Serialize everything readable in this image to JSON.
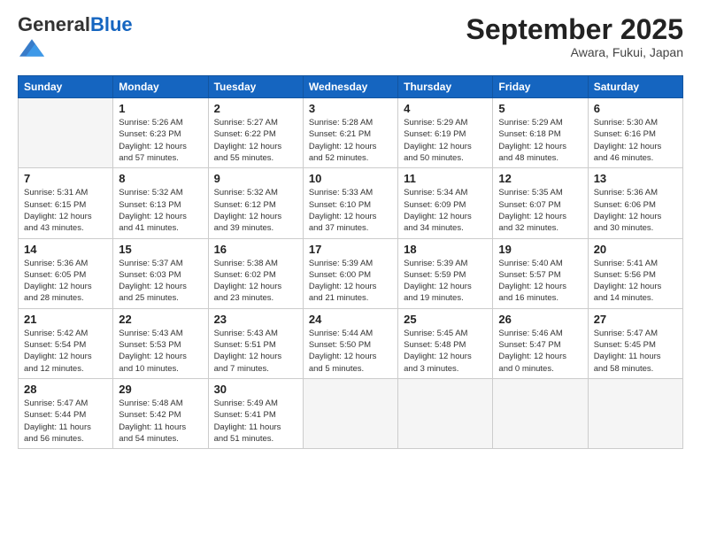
{
  "header": {
    "logo_general": "General",
    "logo_blue": "Blue",
    "month_title": "September 2025",
    "location": "Awara, Fukui, Japan"
  },
  "weekdays": [
    "Sunday",
    "Monday",
    "Tuesday",
    "Wednesday",
    "Thursday",
    "Friday",
    "Saturday"
  ],
  "weeks": [
    [
      {
        "num": "",
        "info": ""
      },
      {
        "num": "1",
        "info": "Sunrise: 5:26 AM\nSunset: 6:23 PM\nDaylight: 12 hours\nand 57 minutes."
      },
      {
        "num": "2",
        "info": "Sunrise: 5:27 AM\nSunset: 6:22 PM\nDaylight: 12 hours\nand 55 minutes."
      },
      {
        "num": "3",
        "info": "Sunrise: 5:28 AM\nSunset: 6:21 PM\nDaylight: 12 hours\nand 52 minutes."
      },
      {
        "num": "4",
        "info": "Sunrise: 5:29 AM\nSunset: 6:19 PM\nDaylight: 12 hours\nand 50 minutes."
      },
      {
        "num": "5",
        "info": "Sunrise: 5:29 AM\nSunset: 6:18 PM\nDaylight: 12 hours\nand 48 minutes."
      },
      {
        "num": "6",
        "info": "Sunrise: 5:30 AM\nSunset: 6:16 PM\nDaylight: 12 hours\nand 46 minutes."
      }
    ],
    [
      {
        "num": "7",
        "info": "Sunrise: 5:31 AM\nSunset: 6:15 PM\nDaylight: 12 hours\nand 43 minutes."
      },
      {
        "num": "8",
        "info": "Sunrise: 5:32 AM\nSunset: 6:13 PM\nDaylight: 12 hours\nand 41 minutes."
      },
      {
        "num": "9",
        "info": "Sunrise: 5:32 AM\nSunset: 6:12 PM\nDaylight: 12 hours\nand 39 minutes."
      },
      {
        "num": "10",
        "info": "Sunrise: 5:33 AM\nSunset: 6:10 PM\nDaylight: 12 hours\nand 37 minutes."
      },
      {
        "num": "11",
        "info": "Sunrise: 5:34 AM\nSunset: 6:09 PM\nDaylight: 12 hours\nand 34 minutes."
      },
      {
        "num": "12",
        "info": "Sunrise: 5:35 AM\nSunset: 6:07 PM\nDaylight: 12 hours\nand 32 minutes."
      },
      {
        "num": "13",
        "info": "Sunrise: 5:36 AM\nSunset: 6:06 PM\nDaylight: 12 hours\nand 30 minutes."
      }
    ],
    [
      {
        "num": "14",
        "info": "Sunrise: 5:36 AM\nSunset: 6:05 PM\nDaylight: 12 hours\nand 28 minutes."
      },
      {
        "num": "15",
        "info": "Sunrise: 5:37 AM\nSunset: 6:03 PM\nDaylight: 12 hours\nand 25 minutes."
      },
      {
        "num": "16",
        "info": "Sunrise: 5:38 AM\nSunset: 6:02 PM\nDaylight: 12 hours\nand 23 minutes."
      },
      {
        "num": "17",
        "info": "Sunrise: 5:39 AM\nSunset: 6:00 PM\nDaylight: 12 hours\nand 21 minutes."
      },
      {
        "num": "18",
        "info": "Sunrise: 5:39 AM\nSunset: 5:59 PM\nDaylight: 12 hours\nand 19 minutes."
      },
      {
        "num": "19",
        "info": "Sunrise: 5:40 AM\nSunset: 5:57 PM\nDaylight: 12 hours\nand 16 minutes."
      },
      {
        "num": "20",
        "info": "Sunrise: 5:41 AM\nSunset: 5:56 PM\nDaylight: 12 hours\nand 14 minutes."
      }
    ],
    [
      {
        "num": "21",
        "info": "Sunrise: 5:42 AM\nSunset: 5:54 PM\nDaylight: 12 hours\nand 12 minutes."
      },
      {
        "num": "22",
        "info": "Sunrise: 5:43 AM\nSunset: 5:53 PM\nDaylight: 12 hours\nand 10 minutes."
      },
      {
        "num": "23",
        "info": "Sunrise: 5:43 AM\nSunset: 5:51 PM\nDaylight: 12 hours\nand 7 minutes."
      },
      {
        "num": "24",
        "info": "Sunrise: 5:44 AM\nSunset: 5:50 PM\nDaylight: 12 hours\nand 5 minutes."
      },
      {
        "num": "25",
        "info": "Sunrise: 5:45 AM\nSunset: 5:48 PM\nDaylight: 12 hours\nand 3 minutes."
      },
      {
        "num": "26",
        "info": "Sunrise: 5:46 AM\nSunset: 5:47 PM\nDaylight: 12 hours\nand 0 minutes."
      },
      {
        "num": "27",
        "info": "Sunrise: 5:47 AM\nSunset: 5:45 PM\nDaylight: 11 hours\nand 58 minutes."
      }
    ],
    [
      {
        "num": "28",
        "info": "Sunrise: 5:47 AM\nSunset: 5:44 PM\nDaylight: 11 hours\nand 56 minutes."
      },
      {
        "num": "29",
        "info": "Sunrise: 5:48 AM\nSunset: 5:42 PM\nDaylight: 11 hours\nand 54 minutes."
      },
      {
        "num": "30",
        "info": "Sunrise: 5:49 AM\nSunset: 5:41 PM\nDaylight: 11 hours\nand 51 minutes."
      },
      {
        "num": "",
        "info": ""
      },
      {
        "num": "",
        "info": ""
      },
      {
        "num": "",
        "info": ""
      },
      {
        "num": "",
        "info": ""
      }
    ]
  ]
}
